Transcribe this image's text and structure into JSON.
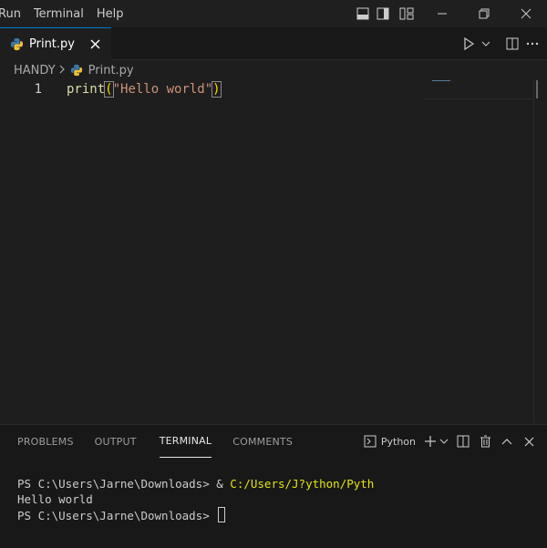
{
  "menu": {
    "items": [
      "Run",
      "Terminal",
      "Help"
    ]
  },
  "tabs": [
    {
      "label": "Print.py",
      "icon": "python-icon",
      "active": true
    }
  ],
  "breadcrumb": {
    "folder": "HANDY",
    "file": "Print.py"
  },
  "editor": {
    "line_number": "1",
    "code": {
      "fn": "print",
      "open": "(",
      "str": "\"Hello world\"",
      "close": ")"
    }
  },
  "panel": {
    "tabs": [
      "PROBLEMS",
      "OUTPUT",
      "TERMINAL",
      "COMMENTS"
    ],
    "active_tab": "TERMINAL",
    "terminal_profile": "Python"
  },
  "terminal": {
    "prompt1": "PS C:\\Users\\Jarne\\Downloads> & ",
    "cmd1": "C:/Users/J?ython/Pyth",
    "output": "Hello world",
    "prompt2": "PS C:\\Users\\Jarne\\Downloads> "
  },
  "colors": {
    "background": "#1e1e1e",
    "function": "#dcdcaa",
    "string": "#ce9178",
    "bracket": "#ffd700",
    "active_tab_border": "#0078d4",
    "terminal_command": "#e5e510"
  }
}
